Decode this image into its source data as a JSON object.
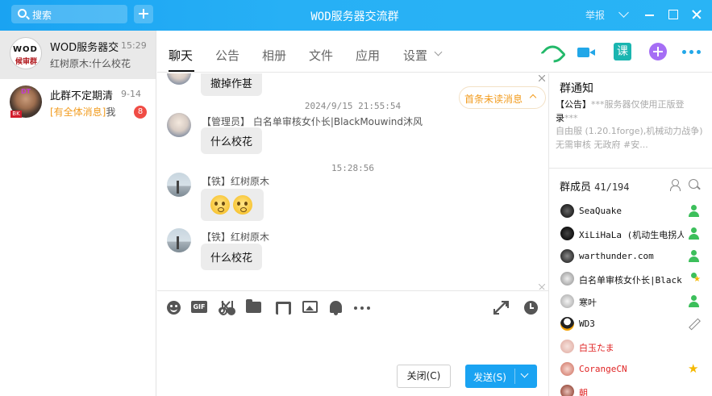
{
  "window": {
    "title": "WOD服务器交流群",
    "report_label": "举报",
    "search_placeholder": "搜索"
  },
  "sessions": [
    {
      "name": "WOD服务器交",
      "time": "15:29",
      "preview": "红树原木:什么校花",
      "avatar_text_1": "WOD",
      "avatar_text_2": "候审群"
    },
    {
      "name": "此群不定期清",
      "time": "9-14",
      "preview_tag": "[有全体消息]",
      "preview": "我",
      "badge": "8",
      "avatar_tag": "BK"
    }
  ],
  "chat": {
    "tabs": [
      "聊天",
      "公告",
      "相册",
      "文件",
      "应用",
      "设置"
    ],
    "active_tab": 0,
    "ke_label": "课",
    "unread_label": "首条未读消息",
    "messages": [
      {
        "text": "撤掉作甚"
      },
      {
        "timestamp": "2024/9/15 21:55:54",
        "sender": "【管理员】 白名单审核女仆长|BlackMouwind沐风",
        "text": "什么校花"
      },
      {
        "timestamp": "15:28:56",
        "sender": "【铁】红树原木",
        "emoji": "grinning-emoji-pair"
      },
      {
        "sender": "【铁】红树原木",
        "text": "什么校花"
      }
    ]
  },
  "toolbar": {
    "icons": [
      "smile-icon",
      "gif-icon",
      "scissors-icon",
      "folder-icon",
      "music-icon",
      "image-icon",
      "bell-icon",
      "more-icon",
      "expand-icon",
      "clock-icon"
    ],
    "gif_label": "GIF"
  },
  "input": {
    "close_label": "关闭(C)",
    "send_label": "发送(S)"
  },
  "notice": {
    "title": "群通知",
    "tag": "【公告】",
    "line1_gray": "***服务器仅使用正版登",
    "line1_cont": "录",
    "line1_end": "***",
    "line2": "自由服 (1.20.1forge),机械动力战争) 无需审核 无政府 #安..."
  },
  "members": {
    "title": "群成员",
    "count": "41/194",
    "list": [
      {
        "name": "SeaQuake",
        "color": "normal",
        "role": "admin"
      },
      {
        "name": "XiLiHaLa (机动生电拐人",
        "color": "normal",
        "role": "admin"
      },
      {
        "name": "warthunder.com",
        "color": "normal",
        "role": "admin"
      },
      {
        "name": "白名单审核女仆长|Black",
        "color": "normal",
        "role": "admin-star"
      },
      {
        "name": "寒叶",
        "color": "normal",
        "role": "admin"
      },
      {
        "name": "WD3",
        "color": "normal",
        "role": "edit"
      },
      {
        "name": "白玉たま",
        "color": "red",
        "role": "none"
      },
      {
        "name": "CorangeCN",
        "color": "red",
        "role": "owner"
      },
      {
        "name": "朝",
        "color": "red",
        "role": "none"
      }
    ]
  },
  "colors": {
    "titlebar": "#1aa3f2",
    "accent": "#1aa3f2",
    "badge": "#f04c45",
    "admin_green": "#3cbf5b",
    "owner_gold": "#f5b800",
    "red_name": "#e02424"
  }
}
